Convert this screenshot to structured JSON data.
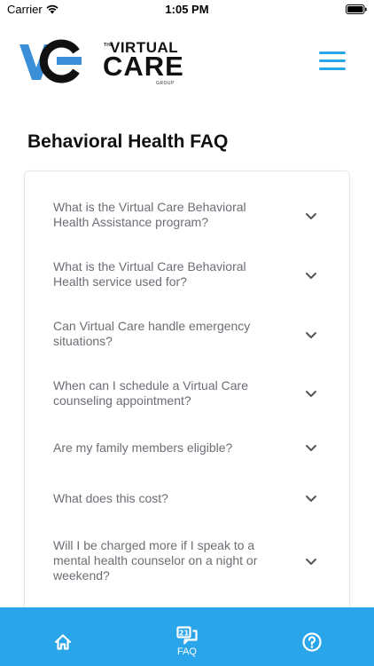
{
  "status_bar": {
    "carrier": "Carrier",
    "time": "1:05 PM"
  },
  "header": {
    "logo": {
      "the": "THE",
      "virtual": "VIRTUAL",
      "care": "CARE",
      "group": "GROUP"
    },
    "menu_icon": "hamburger-menu-icon"
  },
  "page": {
    "title": "Behavioral Health FAQ"
  },
  "faq": {
    "items": [
      {
        "question": "What is the Virtual Care Behavioral Health Assistance program?"
      },
      {
        "question": "What is the Virtual Care Behavioral Health service used for?"
      },
      {
        "question": "Can Virtual Care handle emergency situations?"
      },
      {
        "question": "When can I schedule a Virtual Care counseling appointment?"
      },
      {
        "question": "Are my family members eligible?"
      },
      {
        "question": "What does this cost?"
      },
      {
        "question": "Will I be charged more if I speak to a mental health counselor on a night or weekend?"
      }
    ]
  },
  "tab_bar": {
    "tabs": [
      {
        "icon": "home-icon",
        "label": ""
      },
      {
        "icon": "faq-icon",
        "label": "FAQ"
      },
      {
        "icon": "help-icon",
        "label": ""
      }
    ]
  },
  "colors": {
    "accent": "#2aa5e9",
    "logo_blue": "#3b8fd9",
    "text_muted": "#6b6e75"
  }
}
